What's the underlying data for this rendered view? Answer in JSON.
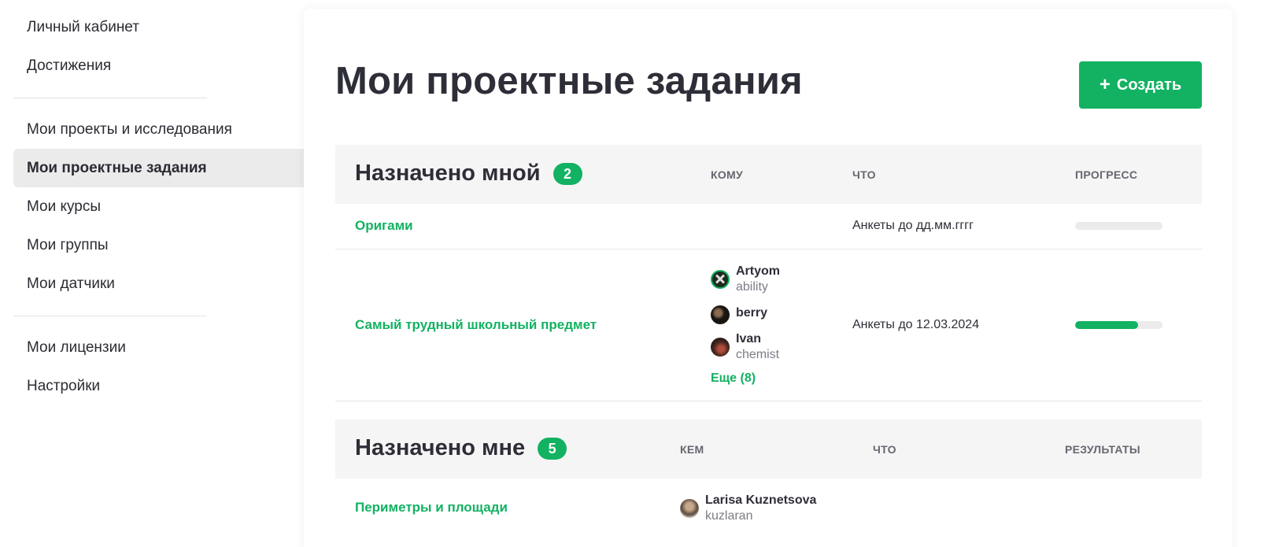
{
  "sidebar": {
    "items": [
      {
        "label": "Личный кабинет"
      },
      {
        "label": "Достижения"
      },
      {
        "label": "Мои проекты и исследования"
      },
      {
        "label": "Мои проектные задания"
      },
      {
        "label": "Мои курсы"
      },
      {
        "label": "Мои группы"
      },
      {
        "label": "Мои датчики"
      },
      {
        "label": "Мои лицензии"
      },
      {
        "label": "Настройки"
      }
    ],
    "active_item": "Мои проектные задания"
  },
  "header": {
    "title": "Мои проектные задания",
    "create_button_label": "Создать",
    "create_button_icon": "plus-icon"
  },
  "assigned_by_me": {
    "title": "Назначено мной",
    "count": "2",
    "columns": {
      "to_whom": "КОМУ",
      "what": "ЧТО",
      "progress": "ПРОГРЕСС"
    },
    "rows": [
      {
        "name": "Оригами",
        "what": "Анкеты до дд.мм.гггг",
        "progress": 0
      },
      {
        "name": "Самый трудный школьный предмет",
        "assignees": [
          {
            "name": "Artyom",
            "login": "ability"
          },
          {
            "name": "berry",
            "login": ""
          },
          {
            "name": "Ivan",
            "login": "chemist"
          }
        ],
        "more_label": "Еще (8)",
        "what": "Анкеты до 12.03.2024",
        "progress": 0.72
      }
    ]
  },
  "assigned_to_me": {
    "title": "Назначено мне",
    "count": "5",
    "columns": {
      "by_whom": "КЕМ",
      "what": "ЧТО",
      "results": "РЕЗУЛЬТАТЫ"
    },
    "rows": [
      {
        "name": "Периметры и площади",
        "assigner": {
          "name": "Larisa Kuznetsova",
          "login": "kuzlaran"
        }
      }
    ]
  },
  "colors": {
    "accent": "#12b262",
    "active_bg": "#ebebeb",
    "header_bg": "#f5f5f5"
  }
}
